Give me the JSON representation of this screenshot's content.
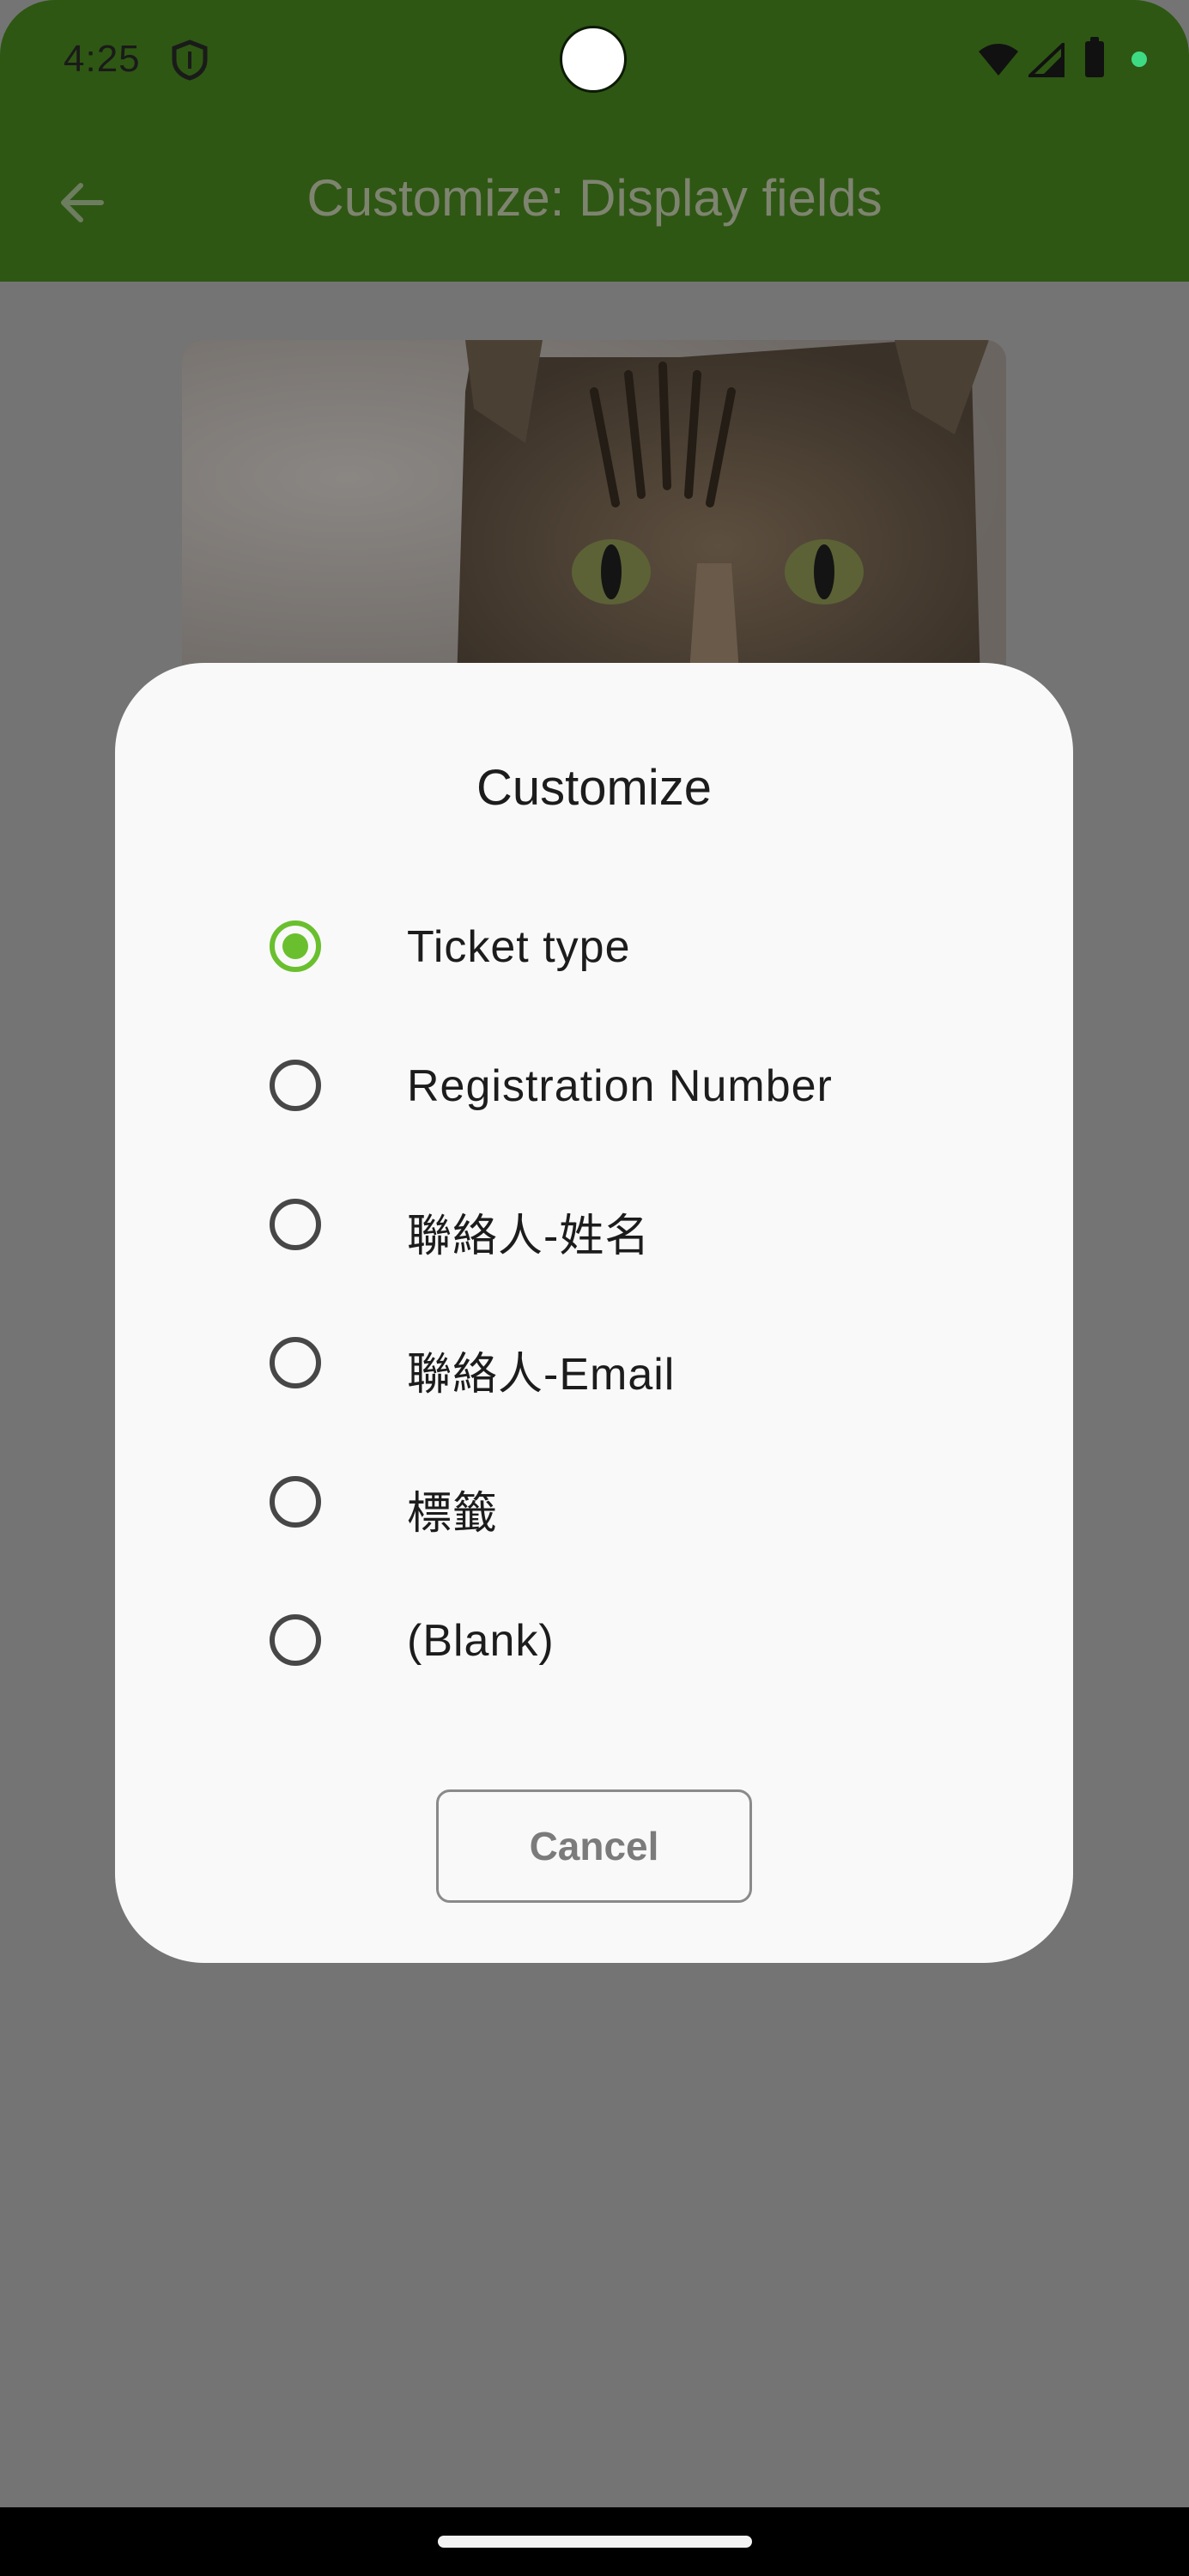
{
  "status_bar": {
    "time": "4:25",
    "icons": [
      "shield-icon",
      "wifi-icon",
      "signal-icon",
      "battery-icon",
      "green-dot-icon"
    ]
  },
  "app_bar": {
    "title": "Customize: Display fields",
    "back_icon": "back-arrow-icon"
  },
  "card": {
    "image": "cat-photo"
  },
  "dialog": {
    "title": "Customize",
    "options": [
      {
        "label": "Ticket type",
        "selected": true
      },
      {
        "label": "Registration Number",
        "selected": false
      },
      {
        "label": "聯絡人-姓名",
        "selected": false
      },
      {
        "label": "聯絡人-Email",
        "selected": false
      },
      {
        "label": "標籤",
        "selected": false
      },
      {
        "label": "(Blank)",
        "selected": false
      }
    ],
    "cancel_label": "Cancel"
  },
  "colors": {
    "app_bar": "#2e5713",
    "scrim": "#747474",
    "accent": "#6abf2e",
    "dialog_bg": "#f9f9f9"
  }
}
